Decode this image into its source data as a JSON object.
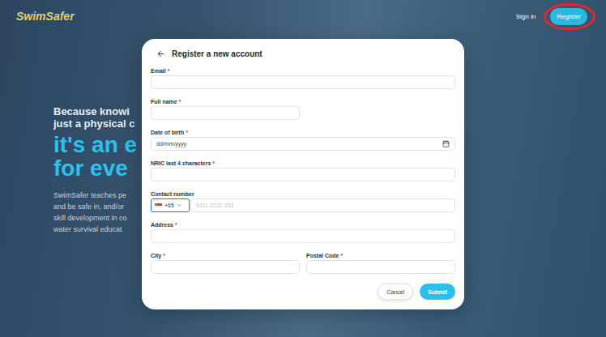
{
  "header": {
    "logo": "SwimSafer",
    "nav": [
      {
        "label": "Sign in",
        "kind": "link",
        "circled": false
      },
      {
        "label": "Register",
        "kind": "button",
        "circled": true
      }
    ]
  },
  "hero": {
    "headline": [
      "Because knowi",
      "just a physical c"
    ],
    "accent": [
      "it's an e",
      "for eve"
    ],
    "body": [
      "SwimSafer teaches pe",
      "and be safe in, and/or",
      "skill development in co",
      "water survival educat"
    ]
  },
  "dialog": {
    "title": "Register a new account",
    "required_mark": "*",
    "rows": [
      [
        {
          "label": "Email",
          "required": true,
          "kind": "text"
        }
      ],
      [
        {
          "label": "Full name",
          "required": true,
          "kind": "short-text"
        }
      ],
      [
        {
          "label": "Date of birth",
          "required": true,
          "kind": "date",
          "placeholder": "dd/mm/yyyy"
        }
      ],
      [
        {
          "label": "NRIC last 4 characters",
          "required": true,
          "kind": "text"
        }
      ],
      [
        {
          "label": "Contact number",
          "required": false,
          "kind": "phone",
          "country_code": "+65",
          "placeholder": "9111-2222-333",
          "country_select_focused": true
        }
      ],
      [
        {
          "label": "Address",
          "required": true,
          "kind": "text"
        }
      ],
      [
        {
          "label": "City",
          "required": true,
          "kind": "short-text"
        },
        {
          "label": "Postal Code",
          "required": true,
          "kind": "short-text"
        }
      ]
    ],
    "buttons": [
      {
        "label": "Cancel",
        "kind": "secondary"
      },
      {
        "label": "Submit",
        "kind": "primary"
      }
    ]
  }
}
